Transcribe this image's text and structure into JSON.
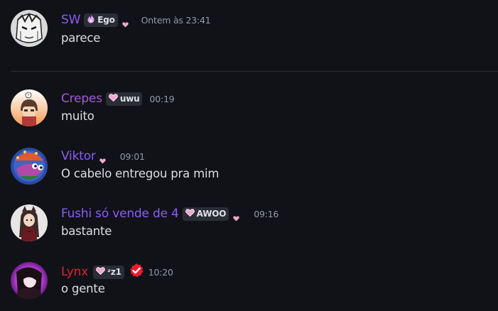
{
  "colors": {
    "background": "#111218",
    "username_purple": "#8c5cf6",
    "username_violet": "#a25ad6",
    "username_red": "#e0232f",
    "timestamp": "#949ba4",
    "message_text": "#dbdee1",
    "tag_bg": "#2b2d36",
    "heart_pink": "#f2a7cf",
    "verified_red": "#ea1c2b"
  },
  "messages": [
    {
      "username": "SW",
      "tag": {
        "label": "Ego",
        "icon": "flame-icon"
      },
      "decoration": "heart-icon",
      "timestamp": "Ontem às 23:41",
      "text": "parece"
    },
    {
      "username": "Crepes",
      "tag": {
        "label": "uwu",
        "icon": "heart-icon"
      },
      "timestamp": "00:19",
      "text": "muito"
    },
    {
      "username": "Viktor",
      "decoration": "heart-icon",
      "timestamp": "09:01",
      "text": "O cabelo entregou pra mim"
    },
    {
      "username": "Fushi só vende de 4",
      "tag": {
        "label": "AWOO",
        "icon": "heart-icon"
      },
      "decoration": "heart-icon",
      "timestamp": "09:16",
      "text": "bastante"
    },
    {
      "username": "Lynx",
      "tag": {
        "label": "ᶻz1",
        "icon": "heart-icon"
      },
      "badge": "verified-icon",
      "timestamp": "10:20",
      "text": "o gente"
    }
  ]
}
